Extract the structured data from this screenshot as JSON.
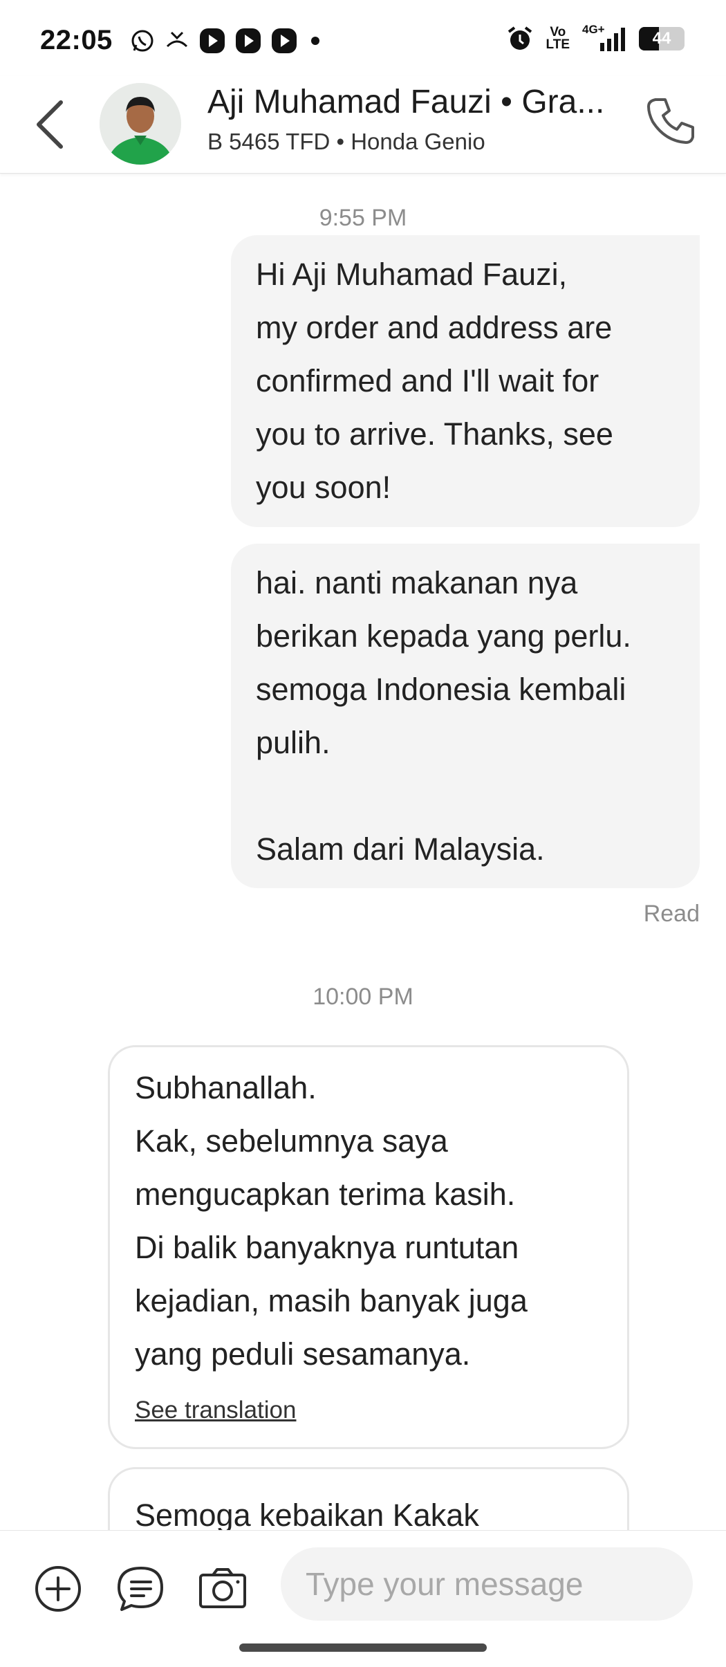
{
  "status_bar": {
    "time": "22:05",
    "volte_top": "Vo",
    "volte_bottom": "LTE",
    "network": "4G+",
    "battery": "44",
    "battery_level": 0.44,
    "left_icons": [
      "whatsapp-icon",
      "missed-call-icon",
      "play-icon",
      "play-icon",
      "play-icon",
      "dot-icon"
    ],
    "right_icons": [
      "alarm-icon",
      "volte-icon",
      "signal-icon",
      "battery-icon"
    ]
  },
  "header": {
    "title": "Aji Muhamad Fauzi • Gra...",
    "subtitle": "B 5465 TFD • Honda Genio",
    "avatar_color": "#21a34a"
  },
  "messages": {
    "time1": "9:55 PM",
    "out1": [
      "Hi Aji Muhamad Fauzi,",
      "my order and address are",
      "confirmed and I'll wait for",
      "you to arrive. Thanks, see",
      "you soon!"
    ],
    "out2": [
      "hai. nanti makanan nya",
      "berikan kepada yang perlu.",
      "semoga Indonesia kembali",
      "pulih.",
      "",
      "Salam dari Malaysia."
    ],
    "read_status": "Read",
    "time2": "10:00 PM",
    "in1": [
      "Subhanallah.",
      "Kak, sebelumnya saya",
      "mengucapkan terima kasih.",
      "Di balik banyaknya runtutan",
      "kejadian, masih banyak juga",
      "yang peduli sesamanya."
    ],
    "see_translation": "See translation",
    "in2": [
      "Semoga kebaikan Kakak"
    ]
  },
  "composer": {
    "placeholder": "Type your message",
    "icons": [
      "add-icon",
      "quick-reply-icon",
      "camera-icon"
    ]
  }
}
